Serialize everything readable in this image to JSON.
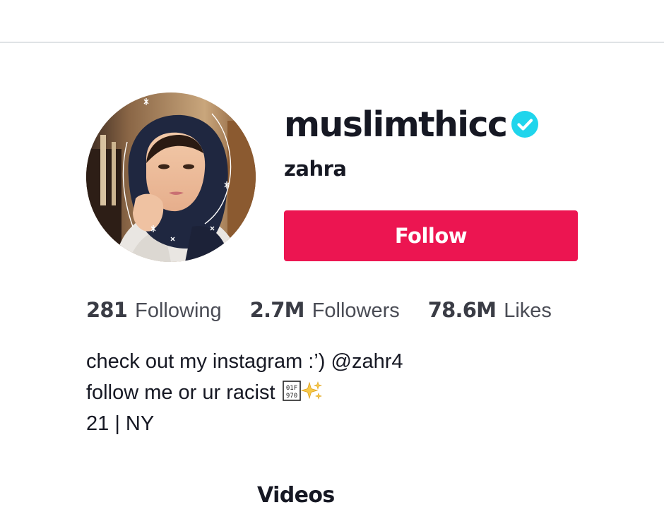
{
  "profile": {
    "username": "muslimthicc",
    "display_name": "zahra",
    "verified": true,
    "verified_color": "#20d5ec",
    "avatar_icon": "profile-photo"
  },
  "actions": {
    "follow_label": "Follow",
    "follow_color": "#ec1551"
  },
  "stats": {
    "following_count": "281",
    "following_label": "Following",
    "followers_count": "2.7M",
    "followers_label": "Followers",
    "likes_count": "78.6M",
    "likes_label": "Likes"
  },
  "bio": {
    "line1": "check out my instagram :’) @zahr4",
    "line2": "follow me or ur racist",
    "line2_emoji": [
      "unknown-glyph-box",
      "sparkles-icon"
    ],
    "line3": "21 | NY"
  },
  "tabs": {
    "videos_label": "Videos"
  }
}
